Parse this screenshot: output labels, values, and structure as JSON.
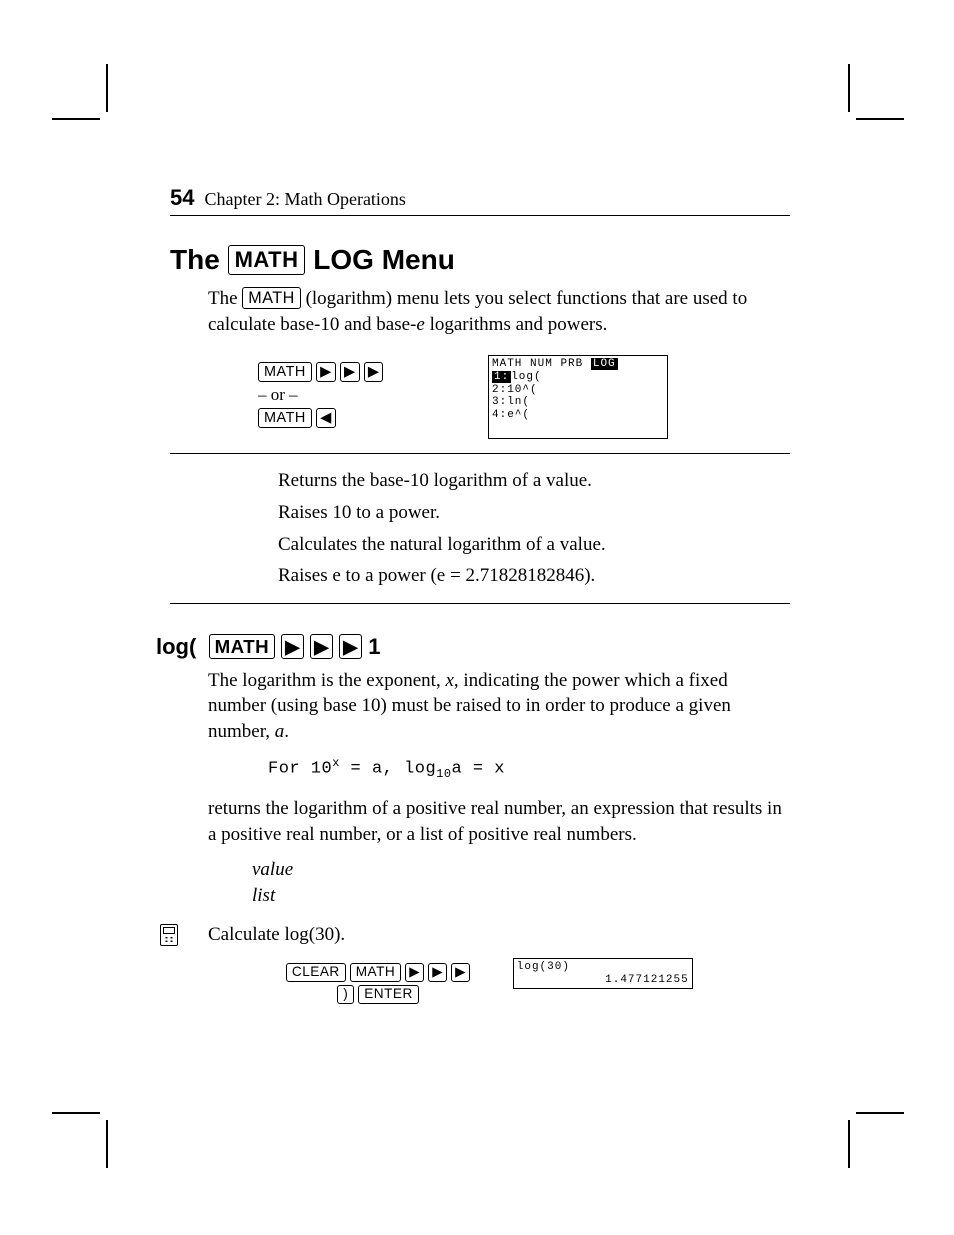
{
  "page_number": "54",
  "running_head": "Chapter 2: Math Operations",
  "h1_prefix": "The ",
  "h1_key": "MATH",
  "h1_suffix": " LOG Menu",
  "intro": {
    "p1a": "The ",
    "key": "MATH",
    "p1b": " (logarithm) menu lets you select functions that are used to calculate base-10 and base-",
    "p1c": " logarithms and powers.",
    "e": "e"
  },
  "nav": {
    "key_math": "MATH",
    "or": "– or –",
    "screen_tabs": {
      "t1": "MATH",
      "t2": "NUM",
      "t3": "PRB",
      "t4": "LOG"
    },
    "menu": [
      "1:log(",
      "2:10^(",
      "3:ln(",
      "4:e^("
    ]
  },
  "functions": [
    "Returns the base-10 logarithm of a value.",
    "Raises 10 to a power.",
    "Calculates the natural logarithm of a value.",
    "Raises e to a power (e = 2.71828182846)."
  ],
  "sub": {
    "name": "log(",
    "key_math": "MATH",
    "trail": " 1"
  },
  "log_desc": {
    "p1a": "The logarithm is the exponent, ",
    "x": "x",
    "p1b": ", indicating the power which a fixed number (using base 10) must be raised to in order to produce a given number, ",
    "a": "a",
    "p1c": "."
  },
  "formula": {
    "lead": "For 10",
    "exp": "x",
    "eq1": " = a,  log",
    "sub": "10",
    "eq2": "a = x"
  },
  "returns": " returns the logarithm of a positive real number, an expression that results in a positive real number, or a list of positive real numbers.",
  "syntax": {
    "s1": "value",
    "s2": "list"
  },
  "example": {
    "prompt": "Calculate log(30).",
    "keys": {
      "clear": "CLEAR",
      "math": "MATH",
      "paren": ")",
      "enter": "ENTER"
    },
    "screen": {
      "l1": "log(30)",
      "l2": "1.477121255"
    }
  }
}
